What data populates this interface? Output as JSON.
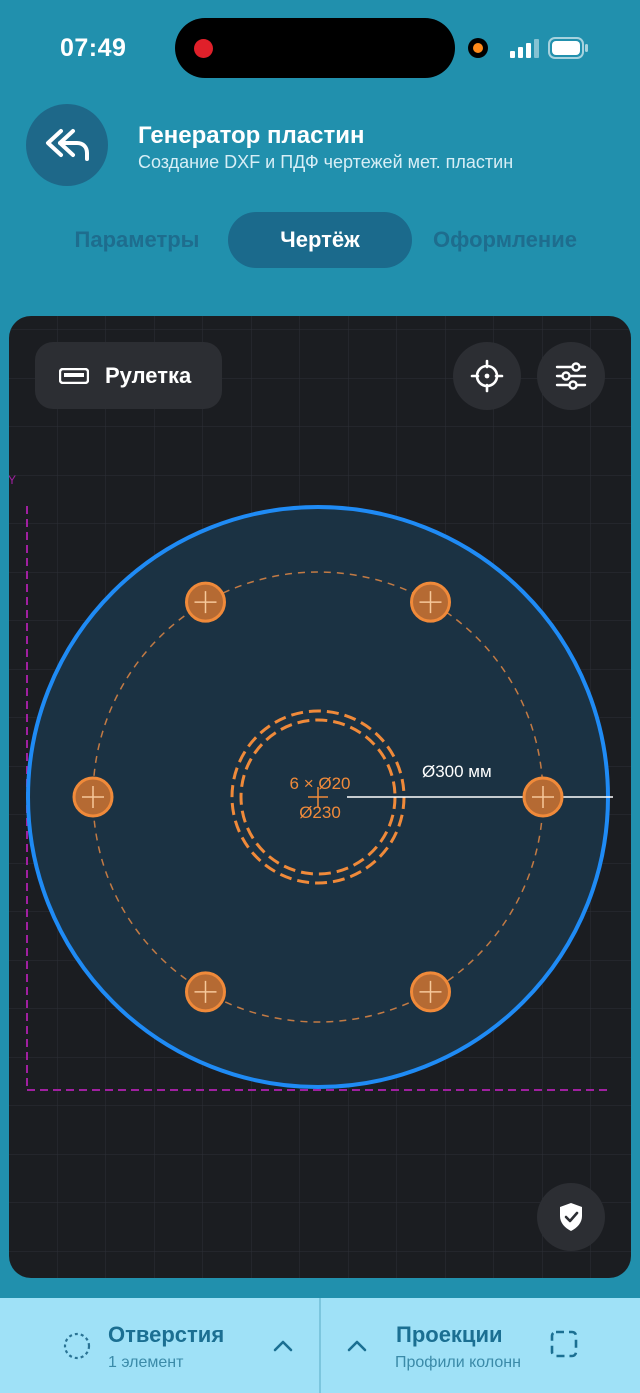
{
  "status_bar": {
    "time": "07:49"
  },
  "header": {
    "title": "Генератор пластин",
    "subtitle": "Создание DXF и ПДФ чертежей мет. пластин"
  },
  "tabs": [
    {
      "label": "Параметры",
      "active": false
    },
    {
      "label": "Чертёж",
      "active": true
    },
    {
      "label": "Оформление",
      "active": false
    }
  ],
  "canvas": {
    "ruler_label": "Рулетка",
    "axis_label": "Y",
    "holes_label": "6 × Ø20",
    "inner_diameter_label": "Ø230",
    "outer_diameter_label": "Ø300 мм",
    "hole_count": 6,
    "colors": {
      "plate_outline": "#1f8bf5",
      "holes": "#f08a3a",
      "frame": "#a020a0",
      "background": "#1b1d21"
    }
  },
  "bottom_bar": {
    "left": {
      "title": "Отверстия",
      "subtitle": "1 элемент"
    },
    "right": {
      "title": "Проекции",
      "subtitle": "Профили колонн"
    }
  },
  "icons": [
    "back-double-arrow-icon",
    "ruler-icon",
    "crosshair-icon",
    "sliders-icon",
    "shield-check-icon",
    "dashed-circle-icon",
    "chevron-up-icon",
    "dashed-square-icon"
  ]
}
